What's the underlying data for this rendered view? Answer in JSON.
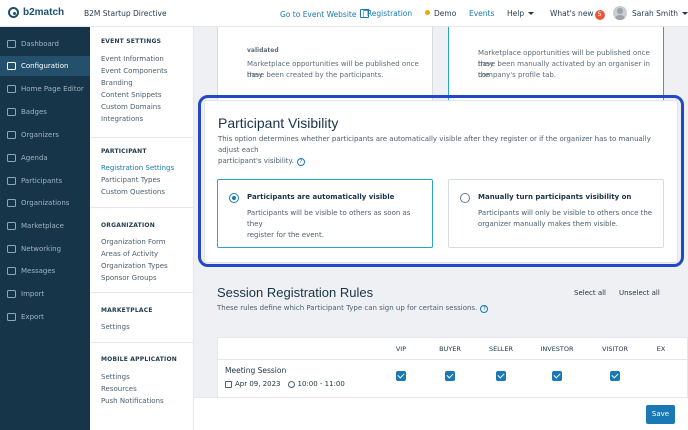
{
  "app": {
    "logo_text": "b2match",
    "event_title": "B2M Startup Directive"
  },
  "topbar": {
    "go_to_event": "Go to Event Website",
    "registration": "| Registration",
    "demo": "Demo",
    "events": "Events",
    "help": "Help",
    "whats_new": "What's new",
    "whats_new_count": "5",
    "user_name": "Sarah Smith"
  },
  "nav": {
    "items": [
      {
        "label": "Dashboard",
        "icon": "dashboard-icon"
      },
      {
        "label": "Configuration",
        "icon": "configuration-icon",
        "active": true
      },
      {
        "label": "Home Page Editor",
        "icon": "home-page-editor-icon"
      },
      {
        "label": "Badges",
        "icon": "badges-icon"
      },
      {
        "label": "Organizers",
        "icon": "organizers-icon"
      },
      {
        "label": "Agenda",
        "icon": "agenda-icon"
      },
      {
        "label": "Participants",
        "icon": "participants-icon"
      },
      {
        "label": "Organizations",
        "icon": "organizations-icon"
      },
      {
        "label": "Marketplace",
        "icon": "marketplace-icon"
      },
      {
        "label": "Networking",
        "icon": "networking-icon"
      },
      {
        "label": "Messages",
        "icon": "messages-icon"
      },
      {
        "label": "Import",
        "icon": "import-icon"
      },
      {
        "label": "Export",
        "icon": "export-icon"
      }
    ]
  },
  "subnav": {
    "event_settings": {
      "heading": "EVENT SETTINGS",
      "links": [
        "Event Information",
        "Event Components",
        "Branding",
        "Content Snippets",
        "Custom Domains",
        "Integrations"
      ]
    },
    "participant": {
      "heading": "PARTICIPANT",
      "links": [
        "Registration Settings",
        "Participant Types",
        "Custom Questions"
      ]
    },
    "organization": {
      "heading": "ORGANIZATION",
      "links": [
        "Organization Form",
        "Areas of Activity",
        "Organization Types",
        "Sponsor Groups"
      ]
    },
    "marketplace": {
      "heading": "MARKETPLACE",
      "links": [
        "Settings"
      ]
    },
    "mobile_application": {
      "heading": "MOBILE APPLICATION",
      "links": [
        "Settings",
        "Resources",
        "Push Notifications"
      ]
    }
  },
  "marketplace_cards": {
    "left": {
      "title": "validated",
      "desc_1": "Marketplace opportunities will be published once they",
      "desc_2": "have been created by the participants."
    },
    "right": {
      "desc_1": "Marketplace opportunities will be published once they",
      "desc_2": "have been manually activated by an organiser in the",
      "desc_3": "company's profile tab."
    }
  },
  "visibility": {
    "title": "Participant Visibility",
    "desc_1": "This option determines whether participants are automatically visible after they register or if the organizer has to manually adjust each",
    "desc_2": "participant's visibility.",
    "options": [
      {
        "title": "Participants are automatically visible",
        "desc_1": "Participants will be visible to others as soon as they",
        "desc_2": "register for the event.",
        "selected": true
      },
      {
        "title": "Manually turn participants visibility on",
        "desc_1": "Participants will only be visible to others once the",
        "desc_2": "organizer manually makes them visible.",
        "selected": false
      }
    ]
  },
  "session_rules": {
    "title": "Session Registration Rules",
    "desc": "These rules define which Participant Type can sign up for certain sessions.",
    "select_all": "Select all",
    "unselect_all": "Unselect all",
    "columns": [
      "VIP",
      "BUYER",
      "SELLER",
      "INVESTOR",
      "VISITOR",
      "EX"
    ],
    "rows": [
      {
        "name": "Meeting Session",
        "date": "Apr 09, 2023",
        "time": "10:00 - 11:00",
        "checked": [
          true,
          true,
          true,
          true,
          true
        ]
      }
    ]
  },
  "footer": {
    "save_label": "Save"
  },
  "colors": {
    "accent": "#1a78b4",
    "nav_bg": "#173549",
    "highlight_outline": "#2447c5"
  }
}
